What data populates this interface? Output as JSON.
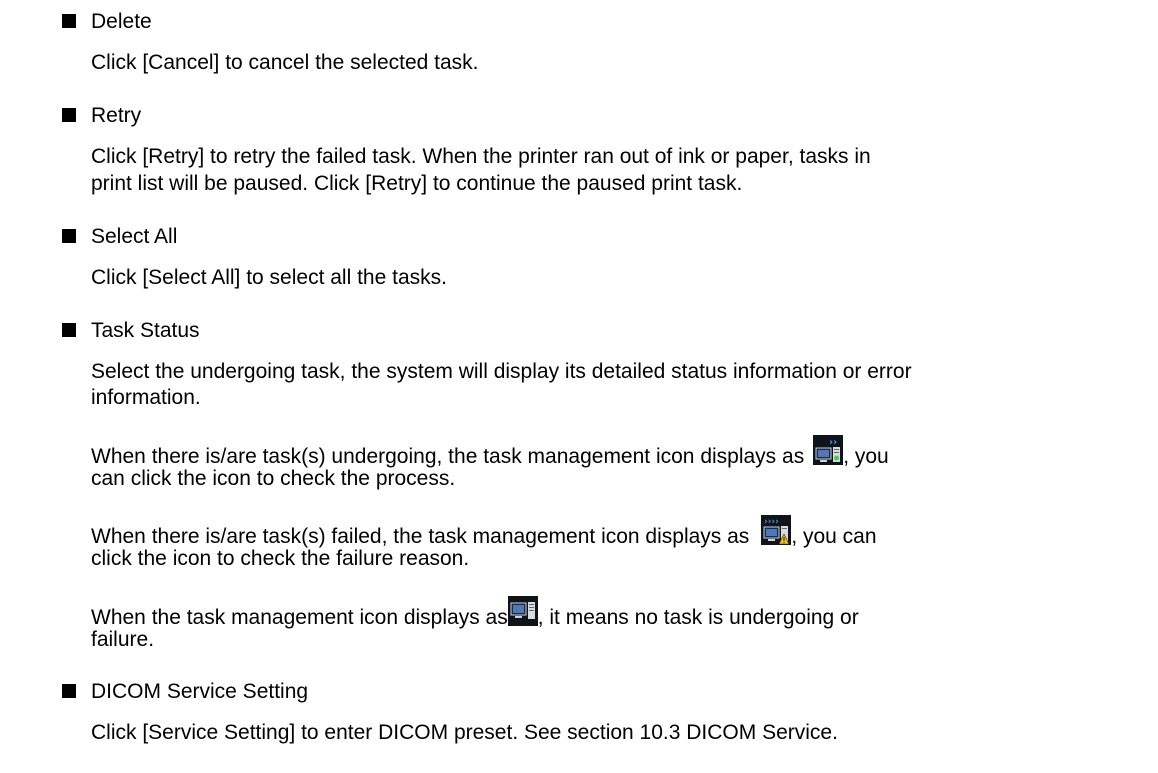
{
  "sections": [
    {
      "heading": "Delete",
      "body": "Click [Cancel] to cancel the selected task."
    },
    {
      "heading": "Retry",
      "body_line1": "Click [Retry] to retry the failed task. When the printer ran out of ink or paper, tasks in",
      "body_line2": "print list will be paused. Click [Retry] to continue the paused print task."
    },
    {
      "heading": "Select All",
      "body": "Click [Select All] to select all the tasks."
    },
    {
      "heading": "Task Status",
      "body_line1": "Select the undergoing task, the system will display its detailed status information or error",
      "body_line2": "information.",
      "undergoing_line1_pre": "When there is/are task(s) undergoing, the task management icon displays as",
      "undergoing_line1_post": ", you",
      "undergoing_line2": "can click the icon to check the process.",
      "failed_line1_pre": "When there is/are task(s) failed, the task management icon displays as",
      "failed_line1_post": ", you can",
      "failed_line2": "click the icon to check the failure reason.",
      "idle_line1_pre": "When the task management icon displays as",
      "idle_line1_post": ", it means no task is undergoing or",
      "idle_line2": "failure."
    },
    {
      "heading": "DICOM Service Setting",
      "body": "Click [Service Setting] to enter DICOM preset. See section 10.3 DICOM Service."
    }
  ],
  "icons": {
    "undergoing": "task-undergoing-icon",
    "failed": "task-failed-icon",
    "idle": "task-idle-icon"
  }
}
